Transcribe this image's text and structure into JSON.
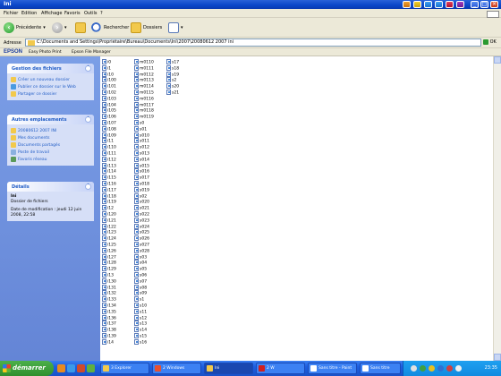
{
  "window": {
    "title": "Ini"
  },
  "menubar": {
    "items": [
      "Fichier",
      "Edition",
      "Affichage",
      "Favoris",
      "Outils",
      "?"
    ]
  },
  "toolbar": {
    "back_label": "Précédente",
    "search_label": "Rechercher",
    "folders_label": "Dossiers"
  },
  "address": {
    "label": "Adresse",
    "value": "C:\\Documents and Settings\\Propriétaire\\Bureau\\Documents\\Ini\\2007\\20080612 2007 ini",
    "go_label": "OK"
  },
  "epson": {
    "logo": "EPSON",
    "items": [
      "Easy Photo Print",
      "Epson File Manager"
    ]
  },
  "leftpane": {
    "file_tasks": {
      "title": "Gestion des fichiers",
      "items": [
        "Créer un nouveau dossier",
        "Publier ce dossier sur le Web",
        "Partager ce dossier"
      ]
    },
    "other_places": {
      "title": "Autres emplacements",
      "items": [
        "20080612 2007 INI",
        "Mes documents",
        "Documents partagés",
        "Poste de travail",
        "Favoris réseau"
      ]
    },
    "details": {
      "title": "Détails",
      "name": "Ini",
      "type": "Dossier de fichiers",
      "modified": "Date de modification : jeudi 12 juin 2008, 22:58"
    }
  },
  "files": {
    "col1": [
      "i0",
      "i1",
      "i10",
      "i100",
      "i101",
      "i102",
      "i103",
      "i104",
      "i105",
      "i106",
      "i107",
      "i108",
      "i109",
      "i11",
      "i110",
      "i111",
      "i112",
      "i113",
      "i114",
      "i115",
      "i116",
      "i117",
      "i118",
      "i119",
      "i12",
      "i120",
      "i121",
      "i122",
      "i123",
      "i124",
      "i125",
      "i126",
      "i127",
      "i128",
      "i129",
      "i13",
      "i130",
      "i131",
      "i132",
      "i133",
      "i134",
      "i135",
      "i136",
      "i137",
      "i138",
      "i139",
      "i14"
    ],
    "col2": [
      "m0110",
      "m0111",
      "m0112",
      "m0113",
      "m0114",
      "m0115",
      "m0116",
      "m0117",
      "m0118",
      "m0119",
      "s0",
      "s01",
      "s010",
      "s011",
      "s012",
      "s013",
      "s014",
      "s015",
      "s016",
      "s017",
      "s018",
      "s019",
      "s02",
      "s020",
      "s021",
      "s022",
      "s023",
      "s024",
      "s025",
      "s026",
      "s027",
      "s028",
      "s03",
      "s04",
      "s05",
      "s06",
      "s07",
      "s08",
      "s09",
      "s1",
      "s10",
      "s11",
      "s12",
      "s13",
      "s14",
      "s15",
      "s16"
    ],
    "col3": [
      "s17",
      "s18",
      "s19",
      "s2",
      "s20",
      "s21"
    ]
  },
  "taskbar": {
    "start_label": "démarrer",
    "tasks": [
      "3 Explorer",
      "2 Windows",
      "Ini",
      "2 W",
      "Sans titre - Paint",
      "Sans titre"
    ],
    "clock": "23:35"
  }
}
